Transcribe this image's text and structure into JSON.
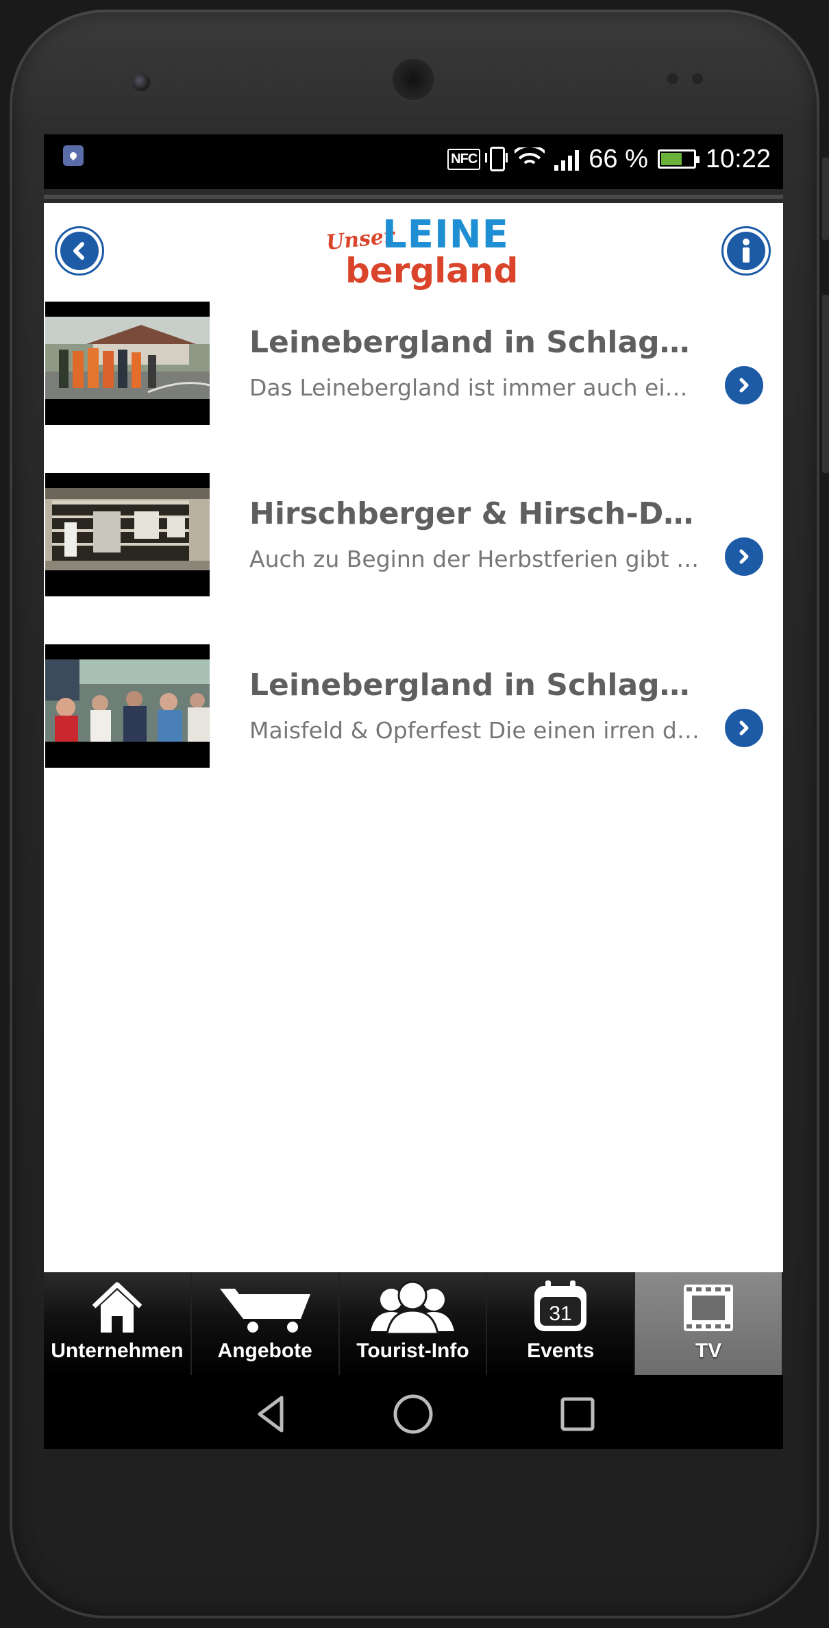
{
  "statusbar": {
    "nfc_label": "NFC",
    "battery_text": "66 %",
    "battery_level": 0.66,
    "time": "10:22"
  },
  "header": {
    "logo": {
      "line1": "Unser",
      "line2": "LEINE",
      "line3": "bergland"
    },
    "back_icon": "chevron-left-icon",
    "info_icon": "info-icon"
  },
  "videos": [
    {
      "title": "Leinebergland in Schlagzeile…",
      "description": "Das Leinebergland ist immer auch eine …"
    },
    {
      "title": "Hirschberger & Hirsch-Drog…",
      "description": "Auch zu Beginn der Herbstferien gibt es…"
    },
    {
      "title": "Leinebergland in Schlagzeile…",
      "description": "Maisfeld & Opferfest Die einen irren dur…"
    }
  ],
  "tabs": [
    {
      "label": "Unternehmen",
      "icon": "home-icon"
    },
    {
      "label": "Angebote",
      "icon": "cart-icon"
    },
    {
      "label": "Tourist-Info",
      "icon": "people-icon"
    },
    {
      "label": "Events",
      "icon": "calendar-icon",
      "icon_text": "31"
    },
    {
      "label": "TV",
      "icon": "film-icon",
      "active": true
    }
  ],
  "colors": {
    "accent": "#1d5ba7",
    "logo_blue": "#1e8fd3",
    "logo_red": "#d9442a"
  }
}
